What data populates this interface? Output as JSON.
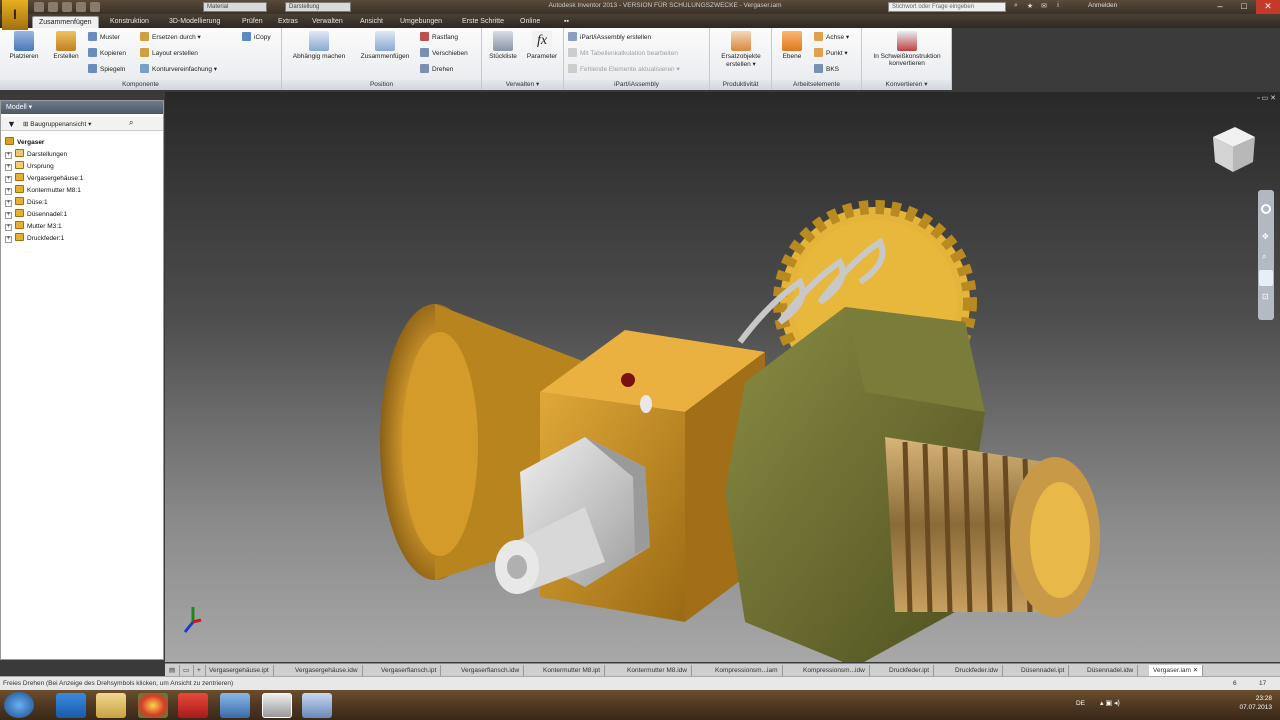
{
  "title_bar": {
    "app_letter": "I",
    "combo1": "Material",
    "combo2": "Darstellung",
    "window_title": "Autodesk Inventor 2013 - VERSION FÜR SCHULUNGSZWECKE - Vergaser.iam",
    "search_placeholder": "Stichwort oder Frage eingeben",
    "user": "Anmelden",
    "minimize": "–",
    "maximize": "□",
    "close": "✕"
  },
  "menu_tabs": [
    "Zusammenfügen",
    "Konstruktion",
    "3D-Modellierung",
    "Prüfen",
    "Extras",
    "Verwalten",
    "Ansicht",
    "Umgebungen",
    "Erste Schritte",
    "Online"
  ],
  "ribbon": {
    "komponente": {
      "name": "Komponente",
      "platzieren": "Platzieren",
      "erstellen": "Erstellen",
      "muster": "Muster",
      "kopieren": "Kopieren",
      "spiegeln": "Spiegeln",
      "ersetzen": "Ersetzen durch",
      "layout": "Layout erstellen",
      "kontur": "Konturvereinfachung",
      "icopy": "iCopy"
    },
    "position": {
      "name": "Position",
      "abhaengig": "Abhängig machen",
      "zusammenfuegen": "Zusammenfügen",
      "rastfang": "Rastfang",
      "verschieben": "Verschieben",
      "drehen": "Drehen"
    },
    "verwalten": {
      "name": "Verwalten",
      "stueckliste": "Stückliste",
      "parameter": "Parameter"
    },
    "ipart": {
      "name": "iPart/iAssembly",
      "erstellen": "iPart/iAssembly erstellen",
      "tabelle": "Mit Tabellenkalkulation bearbeiten",
      "fehlend": "Fehlende Elemente aktualisieren"
    },
    "produktivitaet": {
      "name": "Produktivität",
      "ersatz": "Ersatzobjekte erstellen"
    },
    "arbeitselemente": {
      "name": "Arbeitselemente",
      "ebene": "Ebene",
      "achse": "Achse",
      "punkt": "Punkt",
      "bks": "BKS"
    },
    "konvertieren": {
      "name": "Konvertieren",
      "schweiss": "In Schweißkonstruktion konvertieren"
    }
  },
  "browser": {
    "header": "Modell ▾",
    "view": "Baugruppenansicht",
    "root": "Vergaser",
    "items": [
      "Darstellungen",
      "Ursprung",
      "Vergasergehäuse:1",
      "Kontermutter M8:1",
      "Düse:1",
      "Düsennadel:1",
      "Mutter M3:1",
      "Druckfeder:1"
    ]
  },
  "doc_tabs": [
    "Vergasergehäuse.ipt",
    "Vergasergehäuse.idw",
    "Vergaserflansch.ipt",
    "Vergaserflansch.idw",
    "Kontermutter M8.ipt",
    "Kontermutter M8.idw",
    "Kompressionsm...iam",
    "Kompressionsm...idw",
    "Druckfeder.ipt",
    "Druckfeder.idw",
    "Düsennadel.ipt",
    "Düsennadel.idw",
    "Vergaser.iam"
  ],
  "status": {
    "message": "Freies Drehen (Bei Anzeige des Drehsymbols klicken, um Ansicht zu zentrieren)",
    "count1": "6",
    "count2": "17"
  },
  "taskbar": {
    "lang": "DE",
    "time": "23:28",
    "date": "07.07.2013"
  },
  "colors": {
    "brass": "#c8961e",
    "dark_nut": "#6f7230",
    "gear": "#e8b73a",
    "silver": "#c8c8c8"
  }
}
